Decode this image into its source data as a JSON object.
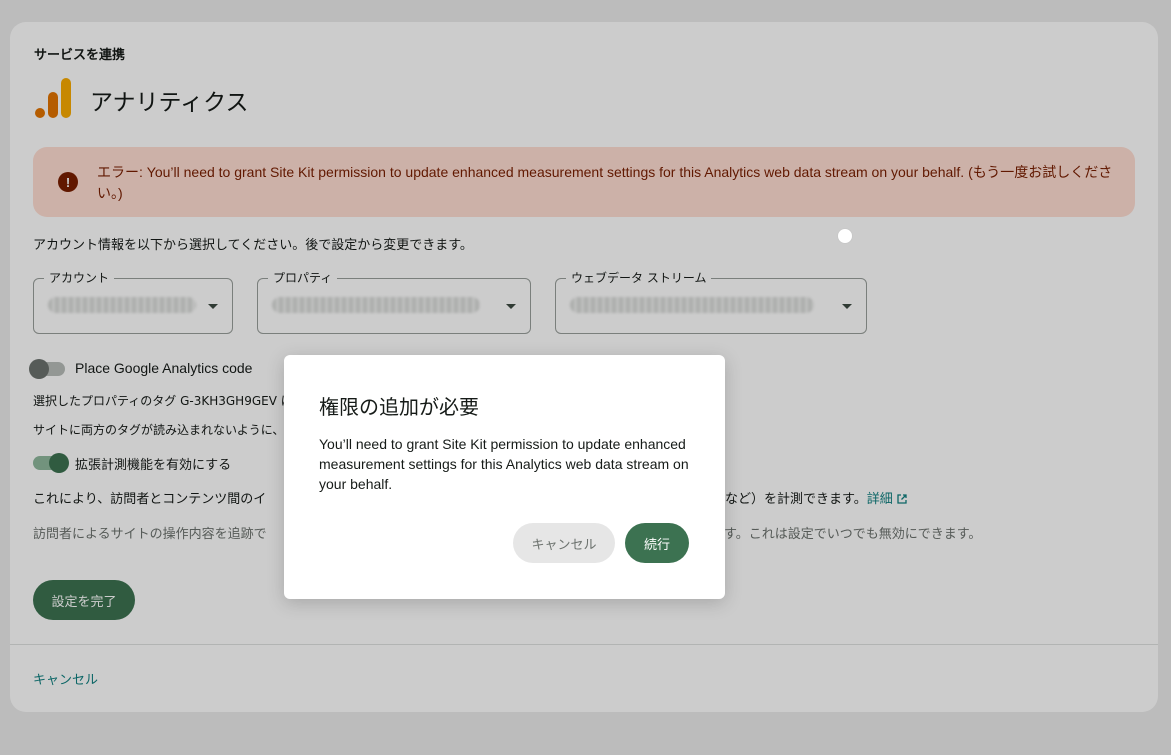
{
  "card": {
    "section_title": "サービスを連携",
    "service_name": "アナリティクス",
    "error_message": "エラー: You’ll need to grant Site Kit permission to update enhanced measurement settings for this Analytics web data stream on your behalf. (もう一度お試しください。)",
    "select_hint": "アカウント情報を以下から選択してください。後で設定から変更できます。",
    "fields": {
      "account_label": "アカウント",
      "property_label": "プロパティ",
      "stream_label": "ウェブデータ ストリーム"
    },
    "place_code": {
      "label": "Place Google Analytics code",
      "enabled": false
    },
    "tag_note_1": "選択したプロパティのタグ G-3KH3GH9GEV は",
    "tag_note_2": "サイトに両方のタグが読み込まれないように、",
    "enhanced_measurement": {
      "label": "拡張計測機能を有効にする",
      "enabled": true
    },
    "measure_desc_start": "これにより、訪問者とコンテンツ間のイ",
    "measure_desc_end": "生など）を計測できます。",
    "learn_more_link": "詳細",
    "privacy_note_start": "訪問者によるサイトの操作内容を追跡で",
    "privacy_note_end": "す。これは設定でいつでも無効にできます。",
    "complete_button": "設定を完了",
    "footer_cancel": "キャンセル"
  },
  "dialog": {
    "title": "権限の追加が必要",
    "body": "You’ll need to grant Site Kit permission to update enhanced measurement settings for this Analytics web data stream on your behalf.",
    "cancel_label": "キャンセル",
    "continue_label": "続行"
  },
  "colors": {
    "primary_green": "#3c7251",
    "error_background": "#ffded3",
    "error_text": "#7a1e00",
    "link": "#108080",
    "logo_orange": "#f9ab00",
    "logo_dark_orange": "#e37400"
  }
}
